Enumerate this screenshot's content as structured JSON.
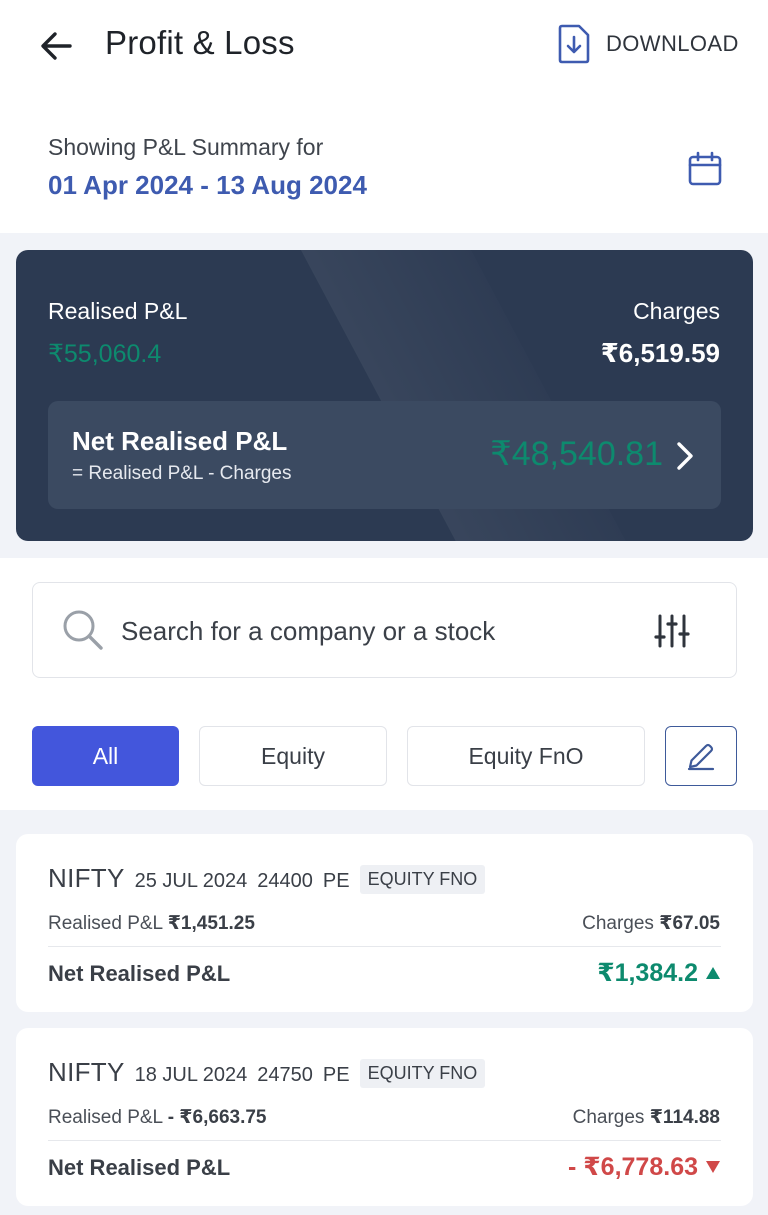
{
  "header": {
    "title": "Profit & Loss",
    "download_label": "DOWNLOAD"
  },
  "summary": {
    "label": "Showing P&L Summary for",
    "date_range": "01 Apr 2024 - 13 Aug 2024"
  },
  "overview": {
    "realised_label": "Realised P&L",
    "realised_value": "₹55,060.4",
    "charges_label": "Charges",
    "charges_value": "₹6,519.59",
    "net_title": "Net Realised P&L",
    "net_formula": "= Realised P&L - Charges",
    "net_value": "₹48,540.81"
  },
  "search": {
    "placeholder": "Search for a company or a stock"
  },
  "filters": {
    "all": "All",
    "equity": "Equity",
    "equity_fno": "Equity FnO",
    "active": "All"
  },
  "positions": [
    {
      "symbol": "NIFTY",
      "expiry": "25 JUL 2024",
      "strike": "24400",
      "option_type": "PE",
      "segment": "EQUITY FNO",
      "realised_label": "Realised P&L",
      "realised_value": "₹1,451.25",
      "charges_label": "Charges",
      "charges_value": "₹67.05",
      "net_label": "Net Realised P&L",
      "net_value": "₹1,384.2",
      "direction": "up"
    },
    {
      "symbol": "NIFTY",
      "expiry": "18 JUL 2024",
      "strike": "24750",
      "option_type": "PE",
      "segment": "EQUITY FNO",
      "realised_label": "Realised P&L",
      "realised_value": "- ₹6,663.75",
      "charges_label": "Charges",
      "charges_value": "₹114.88",
      "net_label": "Net Realised P&L",
      "net_value": "- ₹6,778.63",
      "direction": "down"
    }
  ],
  "colors": {
    "profit": "#0d8a6e",
    "loss": "#d04848",
    "accent": "#4356dc",
    "card_bg": "#2c3a52"
  },
  "icons": {
    "back": "arrow-left-icon",
    "download": "file-download-icon",
    "calendar": "calendar-icon",
    "search": "search-icon",
    "filter": "sliders-icon",
    "edit": "pencil-icon",
    "chevron": "chevron-right-icon"
  }
}
